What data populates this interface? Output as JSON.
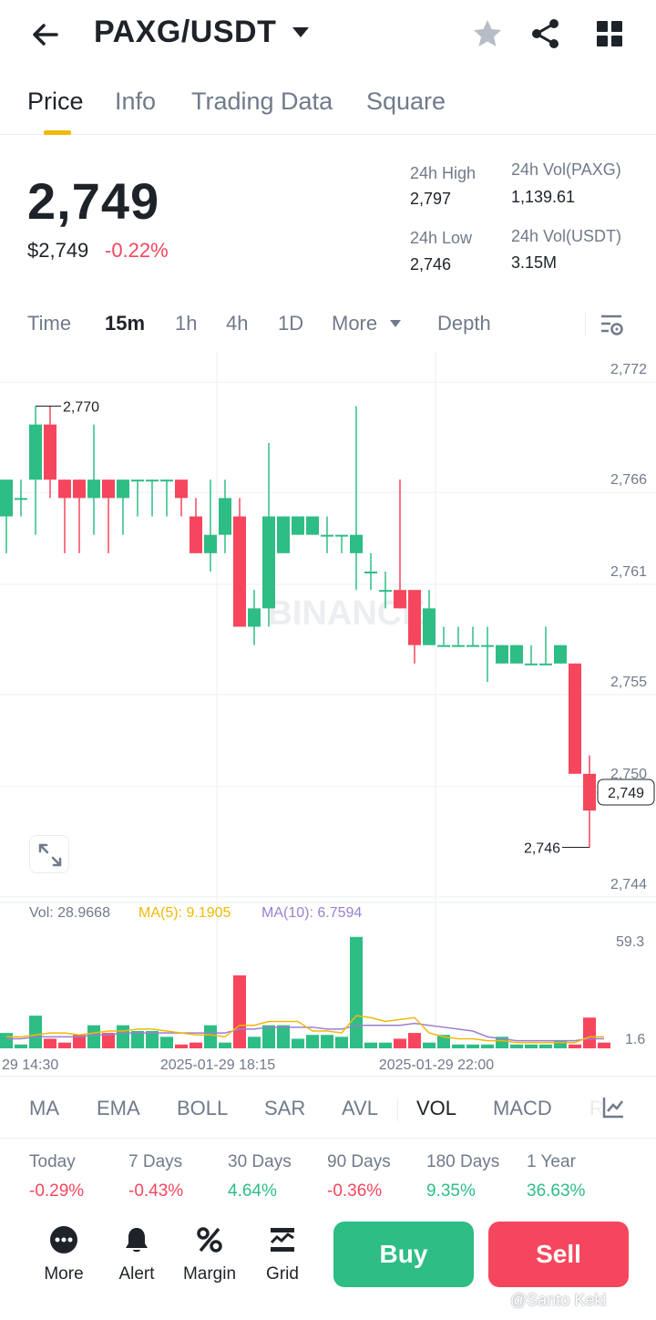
{
  "header": {
    "title": "PAXG/USDT",
    "back_icon": "arrow-left-icon",
    "icons": [
      "star-icon",
      "share-icon",
      "grid-icon"
    ]
  },
  "tabs": [
    {
      "label": "Price",
      "active": true
    },
    {
      "label": "Info",
      "active": false
    },
    {
      "label": "Trading Data",
      "active": false
    },
    {
      "label": "Square",
      "active": false
    }
  ],
  "price": {
    "last": "2,749",
    "usd": "$2,749",
    "change": "-0.22%",
    "high_label": "24h High",
    "high": "2,797",
    "low_label": "24h Low",
    "low": "2,746",
    "vol_base_label": "24h Vol(PAXG)",
    "vol_base": "1,139.61",
    "vol_quote_label": "24h Vol(USDT)",
    "vol_quote": "3.15M"
  },
  "timeframes": {
    "time": "Time",
    "m15": "15m",
    "h1": "1h",
    "h4": "4h",
    "d1": "1D",
    "more": "More",
    "depth": "Depth",
    "active": "15m"
  },
  "chart_data": {
    "type": "candlestick",
    "ylim": [
      2743,
      2773
    ],
    "yticks": [
      "2,772",
      "2,766",
      "2,761",
      "2,755",
      "2,750",
      "2,744"
    ],
    "x_labels": [
      "29 14:30",
      "2025-01-29 18:15",
      "2025-01-29 22:00"
    ],
    "high_marker": "2,770",
    "low_marker": "2,746",
    "last_marker": "2,749",
    "watermark": "BINANCE",
    "candles": [
      {
        "o": 2764,
        "h": 2766,
        "l": 2762,
        "c": 2766
      },
      {
        "o": 2765,
        "h": 2766,
        "l": 2764,
        "c": 2765
      },
      {
        "o": 2766,
        "h": 2770,
        "l": 2763,
        "c": 2769
      },
      {
        "o": 2769,
        "h": 2770,
        "l": 2765,
        "c": 2766
      },
      {
        "o": 2766,
        "h": 2765.5,
        "l": 2762,
        "c": 2765
      },
      {
        "o": 2766,
        "h": 2766,
        "l": 2762,
        "c": 2765
      },
      {
        "o": 2765,
        "h": 2769,
        "l": 2763,
        "c": 2766
      },
      {
        "o": 2766,
        "h": 2766,
        "l": 2762,
        "c": 2765
      },
      {
        "o": 2765,
        "h": 2766,
        "l": 2763,
        "c": 2766
      },
      {
        "o": 2766,
        "h": 2766,
        "l": 2764,
        "c": 2766
      },
      {
        "o": 2766,
        "h": 2766,
        "l": 2764,
        "c": 2766
      },
      {
        "o": 2766,
        "h": 2766,
        "l": 2764,
        "c": 2766
      },
      {
        "o": 2766,
        "h": 2766,
        "l": 2764,
        "c": 2765
      },
      {
        "o": 2764,
        "h": 2765,
        "l": 2762,
        "c": 2762
      },
      {
        "o": 2762,
        "h": 2766,
        "l": 2761,
        "c": 2763
      },
      {
        "o": 2763,
        "h": 2766,
        "l": 2762,
        "c": 2765
      },
      {
        "o": 2764,
        "h": 2765,
        "l": 2758,
        "c": 2758
      },
      {
        "o": 2758,
        "h": 2760,
        "l": 2757,
        "c": 2759
      },
      {
        "o": 2759,
        "h": 2768,
        "l": 2758,
        "c": 2764
      },
      {
        "o": 2762,
        "h": 2764,
        "l": 2762,
        "c": 2764
      },
      {
        "o": 2763,
        "h": 2764,
        "l": 2763,
        "c": 2764
      },
      {
        "o": 2763,
        "h": 2764,
        "l": 2763,
        "c": 2764
      },
      {
        "o": 2763,
        "h": 2764,
        "l": 2762,
        "c": 2763
      },
      {
        "o": 2763,
        "h": 2763,
        "l": 2762,
        "c": 2763
      },
      {
        "o": 2762,
        "h": 2770,
        "l": 2760,
        "c": 2763
      },
      {
        "o": 2761,
        "h": 2762,
        "l": 2760,
        "c": 2761
      },
      {
        "o": 2760,
        "h": 2761,
        "l": 2759,
        "c": 2760
      },
      {
        "o": 2760,
        "h": 2766,
        "l": 2759,
        "c": 2759
      },
      {
        "o": 2760,
        "h": 2760,
        "l": 2756,
        "c": 2757
      },
      {
        "o": 2757,
        "h": 2760,
        "l": 2757,
        "c": 2759
      },
      {
        "o": 2757,
        "h": 2758,
        "l": 2757,
        "c": 2757
      },
      {
        "o": 2757,
        "h": 2758,
        "l": 2757,
        "c": 2757
      },
      {
        "o": 2757,
        "h": 2758,
        "l": 2757,
        "c": 2757
      },
      {
        "o": 2757,
        "h": 2758,
        "l": 2755,
        "c": 2757
      },
      {
        "o": 2756,
        "h": 2757,
        "l": 2756,
        "c": 2757
      },
      {
        "o": 2756,
        "h": 2757,
        "l": 2756,
        "c": 2757
      },
      {
        "o": 2756,
        "h": 2757,
        "l": 2756,
        "c": 2756
      },
      {
        "o": 2756,
        "h": 2758,
        "l": 2756,
        "c": 2756
      },
      {
        "o": 2756,
        "h": 2757,
        "l": 2756,
        "c": 2757
      },
      {
        "o": 2756,
        "h": 2756,
        "l": 2750,
        "c": 2750
      },
      {
        "o": 2750,
        "h": 2751,
        "l": 2746,
        "c": 2748
      }
    ],
    "volume": {
      "label": "Vol: 28.9668",
      "ma5_label": "MA(5): 9.1905",
      "ma10_label": "MA(10): 6.7594",
      "ymax_label": "59.3",
      "ymin_label": "1.6",
      "ymax": 59.3,
      "values": [
        8,
        2,
        17,
        5,
        3,
        7,
        12,
        8,
        12,
        9,
        9,
        6,
        2,
        3,
        12,
        3,
        38,
        6,
        12,
        12,
        5,
        7,
        7,
        6,
        58,
        3,
        3,
        5,
        8,
        3,
        7,
        2,
        2,
        2,
        6,
        2,
        2,
        2,
        4,
        2,
        16,
        3
      ],
      "ma5": [
        6,
        6,
        7,
        8,
        8,
        7,
        8,
        9,
        9,
        10,
        10,
        9,
        8,
        7,
        7,
        6,
        12,
        12,
        14,
        14,
        14,
        9,
        9,
        8,
        17,
        16,
        14,
        15,
        16,
        8,
        6,
        5,
        5,
        4,
        4,
        3,
        3,
        3,
        3,
        3,
        6,
        6
      ],
      "ma10": [
        5,
        5,
        6,
        6,
        6,
        6,
        7,
        7,
        8,
        8,
        8,
        8,
        8,
        8,
        8,
        8,
        10,
        10,
        11,
        11,
        11,
        11,
        10,
        10,
        12,
        12,
        12,
        12,
        13,
        12,
        11,
        10,
        9,
        6,
        5,
        4,
        4,
        4,
        4,
        4,
        5,
        5
      ]
    }
  },
  "indicators": [
    "MA",
    "EMA",
    "BOLL",
    "SAR",
    "AVL",
    "VOL",
    "MACD",
    "R"
  ],
  "indicator_active": "VOL",
  "performance": [
    {
      "label": "Today",
      "value": "-0.29%",
      "dir": "down"
    },
    {
      "label": "7 Days",
      "value": "-0.43%",
      "dir": "down"
    },
    {
      "label": "30 Days",
      "value": "4.64%",
      "dir": "up"
    },
    {
      "label": "90 Days",
      "value": "-0.36%",
      "dir": "down"
    },
    {
      "label": "180 Days",
      "value": "9.35%",
      "dir": "up"
    },
    {
      "label": "1 Year",
      "value": "36.63%",
      "dir": "up"
    }
  ],
  "bottom_bar": {
    "more": "More",
    "alert": "Alert",
    "margin": "Margin",
    "grid": "Grid",
    "buy": "Buy",
    "sell": "Sell"
  },
  "watermark_text": "@Santo Keki",
  "colors": {
    "up": "#2ebd85",
    "down": "#f6465d",
    "accent": "#f0b90b",
    "ma5": "#f0b90b",
    "ma10": "#9b7fd0"
  }
}
